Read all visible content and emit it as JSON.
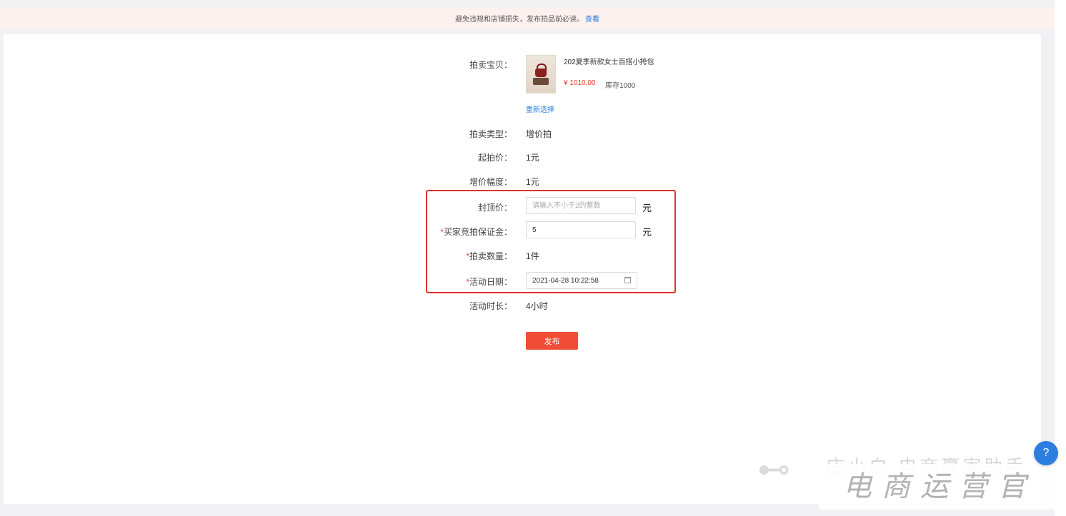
{
  "notice": {
    "text": "避免违规和店铺损失，发布拍品前必读。",
    "link": "查看"
  },
  "product": {
    "label": "拍卖宝贝：",
    "title": "202夏季新款女士百搭小挎包",
    "price": "¥ 1010.00",
    "stock": "库存1000",
    "reselect": "重新选择"
  },
  "form": {
    "auction_type": {
      "label": "拍卖类型：",
      "value": "增价拍"
    },
    "start_price": {
      "label": "起拍价：",
      "value": "1元"
    },
    "increment": {
      "label": "增价幅度：",
      "value": "1元"
    },
    "cap_price": {
      "label": "封顶价：",
      "placeholder": "请输入不小于2的整数",
      "value": "",
      "unit": "元"
    },
    "deposit": {
      "required_mark": "*",
      "label": "买家竞拍保证金：",
      "value": "5",
      "unit": "元"
    },
    "quantity": {
      "required_mark": "*",
      "label": "拍卖数量：",
      "value": "1件"
    },
    "activity_date": {
      "required_mark": "*",
      "label": "活动日期：",
      "value": "2021-04-28 10:22:58"
    },
    "duration": {
      "label": "活动时长：",
      "value": "4小时"
    },
    "publish_label": "发布"
  },
  "watermark": {
    "line1": "庄小白 电商赢家助手",
    "line2": "电商运营官"
  },
  "help_icon": "?",
  "colors": {
    "accent_red": "#f04c36",
    "link_blue": "#2a7ae2",
    "highlight_border": "#e0312a"
  }
}
